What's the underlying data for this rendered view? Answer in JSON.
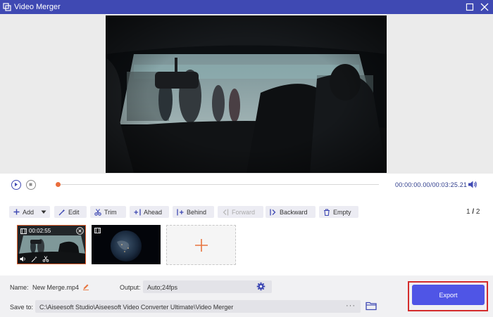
{
  "window": {
    "title": "Video Merger"
  },
  "player": {
    "time_readout": "00:00:00.00/00:03:25.21",
    "progress": 0.0
  },
  "toolbar": {
    "add_label": "Add",
    "edit_label": "Edit",
    "trim_label": "Trim",
    "ahead_label": "Ahead",
    "behind_label": "Behind",
    "forward_label": "Forward",
    "backward_label": "Backward",
    "empty_label": "Empty",
    "page_current": "1",
    "page_separator": "/",
    "page_total": "2"
  },
  "clips": [
    {
      "duration": "00:02:55",
      "selected": true
    }
  ],
  "bottom": {
    "name_label": "Name:",
    "name_value": "New Merge.mp4",
    "output_label": "Output:",
    "output_value": "Auto;24fps",
    "saveto_label": "Save to:",
    "saveto_path": "C:\\Aiseesoft Studio\\Aiseesoft Video Converter Ultimate\\Video Merger",
    "path_more": "···",
    "export_label": "Export"
  },
  "colors": {
    "accent": "#3f49b3",
    "export_button": "#4f55e6",
    "highlight": "#d42c2c",
    "timeline_head": "#ea6d3c"
  }
}
